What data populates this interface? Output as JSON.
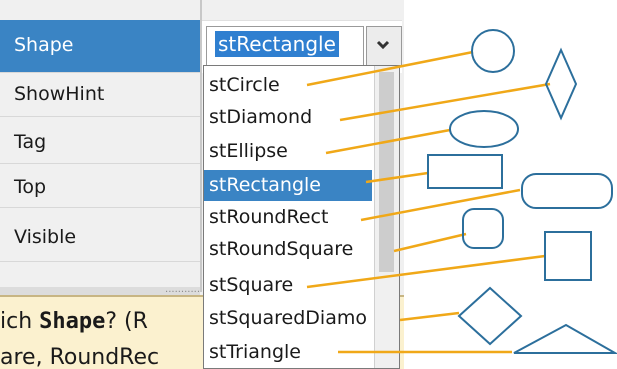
{
  "inspector": {
    "properties": [
      {
        "name": "Shape"
      },
      {
        "name": "ShowHint"
      },
      {
        "name": "Tag"
      },
      {
        "name": "Top"
      },
      {
        "name": "Visible"
      }
    ],
    "selected_value": "stRectangle",
    "selected_property": "Shape"
  },
  "dropdown": {
    "items": [
      "stCircle",
      "stDiamond",
      "stEllipse",
      "stRectangle",
      "stRoundRect",
      "stRoundSquare",
      "stSquare",
      "stSquaredDiamo",
      "stTriangle"
    ],
    "selected": "stRectangle"
  },
  "help": {
    "line1_prefix": "ich ",
    "line1_keyword": "Shape",
    "line1_suffix": "? (R",
    "line2": "are, RoundRec"
  },
  "colors": {
    "selection": "#3a84c4",
    "leader_line": "#f0a818",
    "shape_stroke": "#2c6f9c",
    "help_background": "#fbf1cf"
  },
  "icons": {
    "dropdown_arrow": "chevron-down-icon"
  }
}
